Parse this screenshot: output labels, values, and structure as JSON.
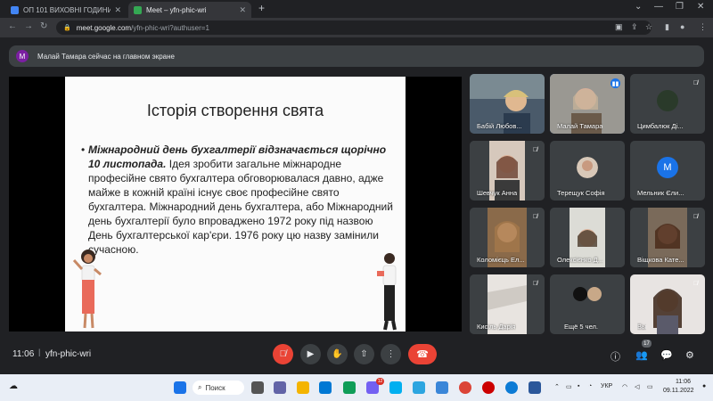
{
  "browser": {
    "tabs": [
      {
        "title": "ОП 101 ВИХОВНІ ГОДИНИ",
        "favicon_color": "#4285f4"
      },
      {
        "title": "Meet – yfn-phic-wri",
        "favicon_color": "#34a853"
      }
    ],
    "url_host": "meet.google.com",
    "url_path": "/yfn-phic-wri?authuser=1"
  },
  "banner": {
    "avatar_letter": "М",
    "text": "Малай Тамара сейчас на главном экране"
  },
  "slide": {
    "title": "Історія створення свята",
    "bold_text": "Міжнародний день бухгалтерії відзначається щорічно 10 листопада.",
    "body_text": " Ідея зробити загальне міжнародне професійне свято бухгалтера обговорювалася давно, адже майже в кожній країні існує своє професійне свято бухгалтера. Міжнародний день бухгалтера, або Міжнародний день бухгалтерії було впроваджено 1972 року під назвою День бухгалтерської кар'єри. 1976 року цю назву замінили сучасною."
  },
  "participants": [
    {
      "name": "Бабій Любов...",
      "bg": "#4a5a6a",
      "muted": false
    },
    {
      "name": "Малай Тамара",
      "bg": "#8a8a8a",
      "muted": false,
      "speaking": true
    },
    {
      "name": "Цимбалюк Ді...",
      "bg": "#3c4043",
      "muted": true,
      "avatar": "photo"
    },
    {
      "name": "Шевчук Анна",
      "bg": "#3c4043",
      "muted": true
    },
    {
      "name": "Терещук Софія",
      "bg": "#3c4043",
      "muted": true,
      "avatar": "photo"
    },
    {
      "name": "Мельник Єли...",
      "bg": "#3c4043",
      "muted": true,
      "avatar_letter": "М"
    },
    {
      "name": "Коломієць Ел...",
      "bg": "#5a4a3a",
      "muted": true
    },
    {
      "name": "Олексієнко Д...",
      "bg": "#3c4043",
      "muted": true
    },
    {
      "name": "Віщкова Кате...",
      "bg": "#6a5a4a",
      "muted": true
    },
    {
      "name": "Кисіль Дарія",
      "bg": "#3c4043",
      "muted": true
    },
    {
      "name": "Ещё 5 чел.",
      "bg": "#3c4043",
      "muted": false
    },
    {
      "name": "Вы",
      "bg": "#d8d0cc",
      "muted": true
    }
  ],
  "controls": {
    "time": "11:06",
    "meeting_code": "yfn-phic-wri",
    "participants_count": "17",
    "buttons": [
      "mic-off-icon",
      "camera-icon",
      "raise-hand-icon",
      "present-icon",
      "more-icon"
    ]
  },
  "taskbar": {
    "search_label": "Поиск",
    "language": "УКР",
    "clock_time": "11:06",
    "clock_date": "09.11.2022",
    "viber_badge": "12"
  }
}
